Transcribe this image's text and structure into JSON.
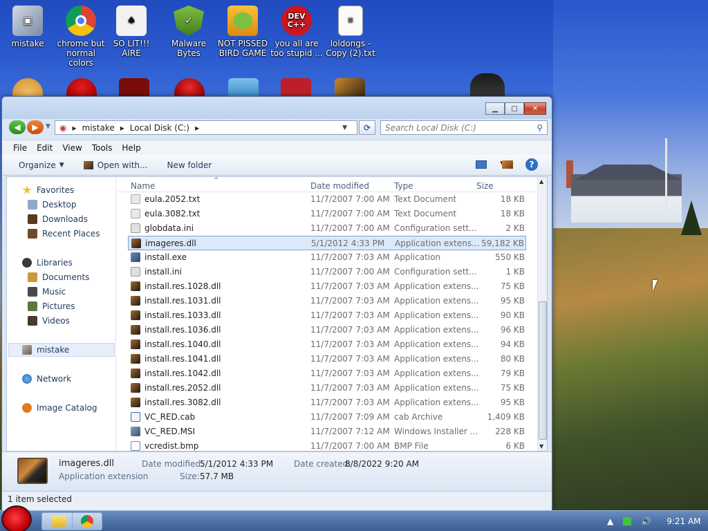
{
  "desktop": {
    "icons": [
      {
        "label_line1": "mistake",
        "label_line2": ""
      },
      {
        "label_line1": "chrome but",
        "label_line2": "normal colors"
      },
      {
        "label_line1": "SO LIT!!! AIRE",
        "label_line2": ""
      },
      {
        "label_line1": "Malware",
        "label_line2": "Bytes"
      },
      {
        "label_line1": "NOT PISSED",
        "label_line2": "BIRD GAME"
      },
      {
        "label_line1": "you all are",
        "label_line2": "too stupid ..."
      },
      {
        "label_line1": "loldongs -",
        "label_line2": "Copy (2).txt"
      }
    ],
    "devcpp_line1": "DEV",
    "devcpp_line2": "C++"
  },
  "window": {
    "address_crumbs": [
      "mistake",
      "Local Disk (C:)"
    ],
    "search_placeholder": "Search Local Disk (C:)",
    "menu": [
      "File",
      "Edit",
      "View",
      "Tools",
      "Help"
    ],
    "toolbar": {
      "organize": "Organize",
      "open_with": "Open with...",
      "new_folder": "New folder"
    },
    "nav": {
      "favorites": "Favorites",
      "desktop": "Desktop",
      "downloads": "Downloads",
      "recent_places": "Recent Places",
      "libraries": "Libraries",
      "documents": "Documents",
      "music": "Music",
      "pictures": "Pictures",
      "videos": "Videos",
      "mistake": "mistake",
      "network": "Network",
      "image_catalog": "Image Catalog"
    },
    "columns": {
      "name": "Name",
      "date": "Date modified",
      "type": "Type",
      "size": "Size"
    },
    "files": [
      {
        "name": "eula.2052.txt",
        "date": "11/7/2007 7:00 AM",
        "type": "Text Document",
        "size": "18 KB"
      },
      {
        "name": "eula.3082.txt",
        "date": "11/7/2007 7:00 AM",
        "type": "Text Document",
        "size": "18 KB"
      },
      {
        "name": "globdata.ini",
        "date": "11/7/2007 7:00 AM",
        "type": "Configuration sett...",
        "size": "2 KB"
      },
      {
        "name": "imageres.dll",
        "date": "5/1/2012 4:33 PM",
        "type": "Application extens...",
        "size": "59,182 KB"
      },
      {
        "name": "install.exe",
        "date": "11/7/2007 7:03 AM",
        "type": "Application",
        "size": "550 KB"
      },
      {
        "name": "install.ini",
        "date": "11/7/2007 7:00 AM",
        "type": "Configuration sett...",
        "size": "1 KB"
      },
      {
        "name": "install.res.1028.dll",
        "date": "11/7/2007 7:03 AM",
        "type": "Application extens...",
        "size": "75 KB"
      },
      {
        "name": "install.res.1031.dll",
        "date": "11/7/2007 7:03 AM",
        "type": "Application extens...",
        "size": "95 KB"
      },
      {
        "name": "install.res.1033.dll",
        "date": "11/7/2007 7:03 AM",
        "type": "Application extens...",
        "size": "90 KB"
      },
      {
        "name": "install.res.1036.dll",
        "date": "11/7/2007 7:03 AM",
        "type": "Application extens...",
        "size": "96 KB"
      },
      {
        "name": "install.res.1040.dll",
        "date": "11/7/2007 7:03 AM",
        "type": "Application extens...",
        "size": "94 KB"
      },
      {
        "name": "install.res.1041.dll",
        "date": "11/7/2007 7:03 AM",
        "type": "Application extens...",
        "size": "80 KB"
      },
      {
        "name": "install.res.1042.dll",
        "date": "11/7/2007 7:03 AM",
        "type": "Application extens...",
        "size": "79 KB"
      },
      {
        "name": "install.res.2052.dll",
        "date": "11/7/2007 7:03 AM",
        "type": "Application extens...",
        "size": "75 KB"
      },
      {
        "name": "install.res.3082.dll",
        "date": "11/7/2007 7:03 AM",
        "type": "Application extens...",
        "size": "95 KB"
      },
      {
        "name": "VC_RED.cab",
        "date": "11/7/2007 7:09 AM",
        "type": "cab Archive",
        "size": "1,409 KB"
      },
      {
        "name": "VC_RED.MSI",
        "date": "11/7/2007 7:12 AM",
        "type": "Windows Installer ...",
        "size": "228 KB"
      },
      {
        "name": "vcredist.bmp",
        "date": "11/7/2007 7:00 AM",
        "type": "BMP File",
        "size": "6 KB"
      }
    ],
    "details": {
      "name": "imageres.dll",
      "type": "Application extension",
      "date_modified_label": "Date modified:",
      "date_modified": "5/1/2012 4:33 PM",
      "date_created_label": "Date created:",
      "date_created": "8/8/2022 9:20 AM",
      "size_label": "Size:",
      "size": "57.7 MB"
    },
    "status": "1 item selected"
  },
  "taskbar": {
    "clock": "9:21 AM"
  }
}
